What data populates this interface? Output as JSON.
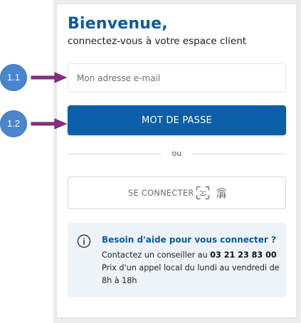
{
  "login": {
    "title": "Bienvenue,",
    "subtitle": "connectez-vous à votre espace client",
    "email_placeholder": "Mon adresse e-mail",
    "password_button": "MOT DE PASSE",
    "divider_text": "ou",
    "biometric_label": "SE CONNECTER"
  },
  "help": {
    "title": "Besoin d'aide pour vous connecter ?",
    "prefix": "Contactez un conseiller au",
    "phone": "03 21 23 83 00",
    "details": "Prix d'un appel local du lundi au vendredi de 8h à 18h"
  },
  "annotations": {
    "marker_1": "1.1",
    "marker_2": "1.2"
  },
  "icons": {
    "face": "face-id-icon",
    "fingerprint": "fingerprint-icon",
    "info": "info-icon",
    "arrow": "right-arrow-icon"
  },
  "colors": {
    "brand_blue": "#0a5aa3",
    "button_blue": "#0b5ea8",
    "help_background": "#eef3f8",
    "marker_blue": "#4a86cf",
    "arrow_purple": "#8e2a8a"
  }
}
